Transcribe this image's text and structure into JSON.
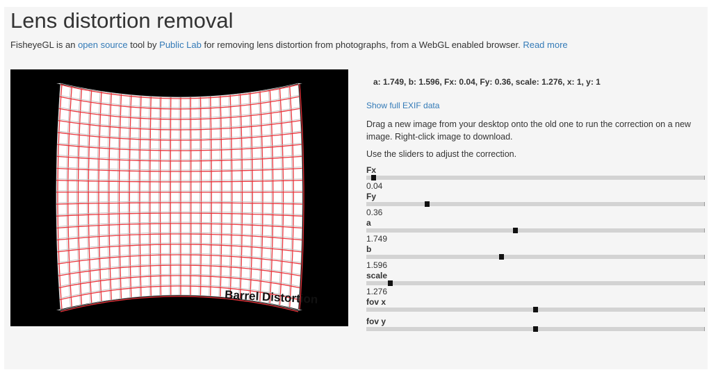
{
  "header": {
    "title": "Lens distortion removal",
    "intro": {
      "t1": "FisheyeGL is an ",
      "link1": "open source",
      "t2": " tool by ",
      "link2": "Public Lab",
      "t3": " for removing lens distortion from photographs, from a WebGL enabled browser. ",
      "link3": "Read more"
    }
  },
  "image": {
    "caption": "Barrel Distortion",
    "grid_color": "#e8343b"
  },
  "panel": {
    "params": "a: 1.749, b: 1.596, Fx: 0.04, Fy: 0.36, scale: 1.276, x: 1, y: 1",
    "exif_link": "Show full EXIF data",
    "description": "Drag a new image from your desktop onto the old one to run the correction on a new image. Right-click image to download.",
    "hint": "Use the sliders to adjust the correction."
  },
  "sliders": [
    {
      "label": "Fx",
      "value": "0.04",
      "position": 0.02,
      "show_value": true
    },
    {
      "label": "Fy",
      "value": "0.36",
      "position": 0.18,
      "show_value": true
    },
    {
      "label": "a",
      "value": "1.749",
      "position": 0.44,
      "show_value": true
    },
    {
      "label": "b",
      "value": "1.596",
      "position": 0.4,
      "show_value": true
    },
    {
      "label": "scale",
      "value": "1.276",
      "position": 0.07,
      "show_value": true
    },
    {
      "label": "fov x",
      "value": "",
      "position": 0.5,
      "show_value": false
    },
    {
      "label": "fov y",
      "value": "",
      "position": 0.5,
      "show_value": false
    }
  ]
}
